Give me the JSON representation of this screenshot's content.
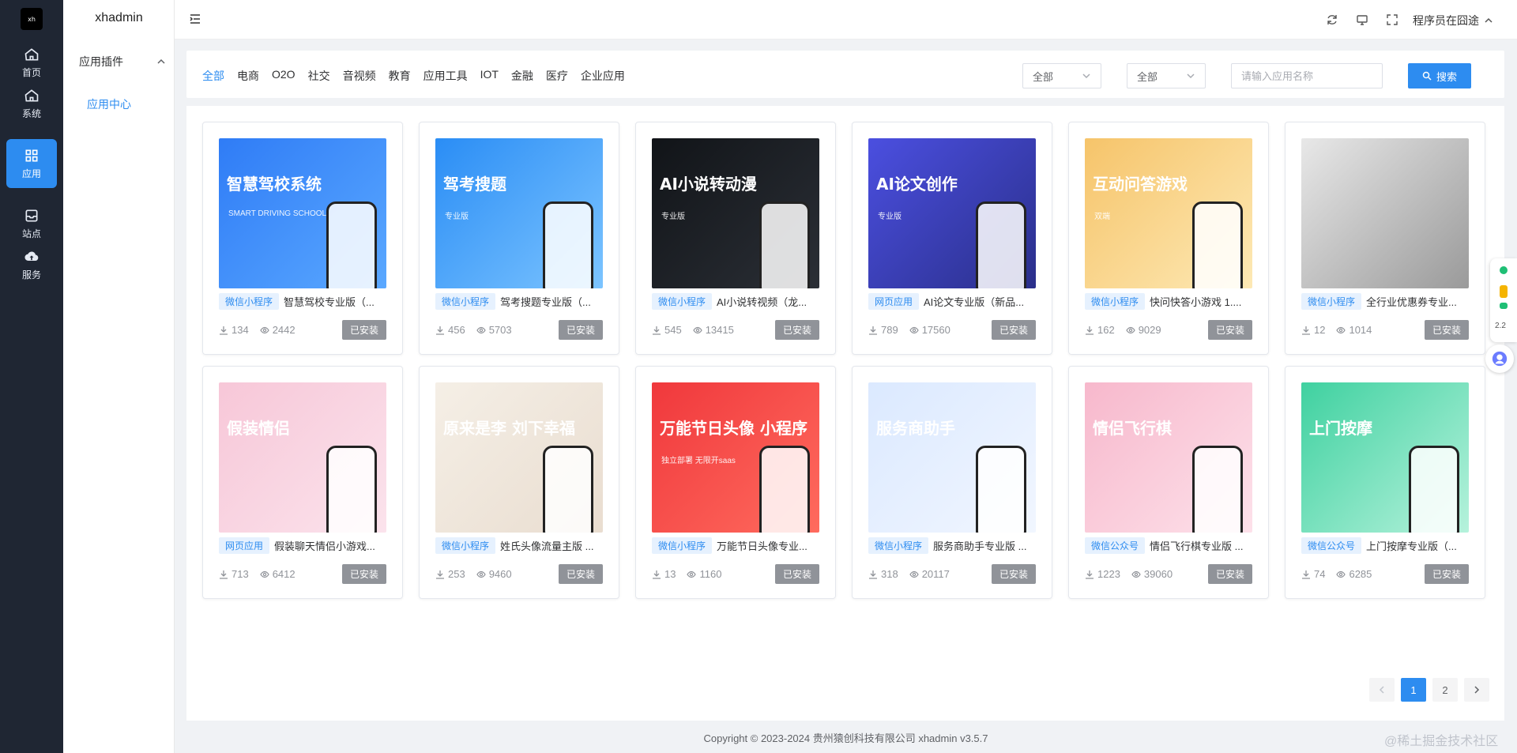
{
  "app": {
    "logo_text": "xh",
    "title": "xhadmin"
  },
  "rail": [
    {
      "label": "首页",
      "icon": "home-icon"
    },
    {
      "label": "系统",
      "icon": "home-icon"
    },
    {
      "label": "应用",
      "icon": "grid-icon"
    },
    {
      "label": "站点",
      "icon": "inbox-icon"
    },
    {
      "label": "服务",
      "icon": "cloud-upload-icon"
    }
  ],
  "panel": {
    "group": "应用插件",
    "link": "应用中心"
  },
  "header": {
    "user": "程序员在囧途"
  },
  "filters": {
    "categories": [
      "全部",
      "电商",
      "O2O",
      "社交",
      "音视频",
      "教育",
      "应用工具",
      "IOT",
      "金融",
      "医疗",
      "企业应用"
    ],
    "select1": "全部",
    "select2": "全部",
    "search_placeholder": "请输入应用名称",
    "search_button": "搜索"
  },
  "apps": [
    {
      "thumb_title": "智慧驾校系统",
      "thumb_sub": "SMART DRIVING SCHOOL",
      "tag": "微信小程序",
      "name": "智慧驾校专业版（...",
      "downloads": "134",
      "views": "2442",
      "status": "已安装",
      "bg": "#2f7cf6",
      "bg2": "#5aa8ff"
    },
    {
      "thumb_title": "驾考搜题",
      "thumb_sub": "专业版",
      "tag": "微信小程序",
      "name": "驾考搜题专业版（...",
      "downloads": "456",
      "views": "5703",
      "status": "已安装",
      "bg": "#2a8df5",
      "bg2": "#7cc4ff"
    },
    {
      "thumb_title": "AI小说转动漫",
      "thumb_sub": "专业版",
      "tag": "微信小程序",
      "name": "AI小说转视频（龙...",
      "downloads": "545",
      "views": "13415",
      "status": "已安装",
      "bg": "#111418",
      "bg2": "#2b2f36"
    },
    {
      "thumb_title": "AI论文创作",
      "thumb_sub": "专业版",
      "tag": "网页应用",
      "name": "AI论文专业版（新品...",
      "downloads": "789",
      "views": "17560",
      "status": "已安装",
      "bg": "#4b4fe0",
      "bg2": "#2a2f8a"
    },
    {
      "thumb_title": "互动问答游戏",
      "thumb_sub": "双端",
      "tag": "微信小程序",
      "name": "快问快答小游戏 1....",
      "downloads": "162",
      "views": "9029",
      "status": "已安装",
      "bg": "#f6c46a",
      "bg2": "#fde9b5"
    },
    {
      "thumb_title": "",
      "thumb_sub": "",
      "tag": "微信小程序",
      "name": "全行业优惠券专业...",
      "downloads": "12",
      "views": "1014",
      "status": "已安装",
      "bg": "#e8e8e8",
      "bg2": "#9a9a9a"
    },
    {
      "thumb_title": "假装情侣",
      "thumb_sub": "",
      "tag": "网页应用",
      "name": "假装聊天情侣小游戏...",
      "downloads": "713",
      "views": "6412",
      "status": "已安装",
      "bg": "#f7c7d8",
      "bg2": "#fbe3ec"
    },
    {
      "thumb_title": "原来是李 刘下幸福",
      "thumb_sub": "",
      "tag": "微信小程序",
      "name": "姓氏头像流量主版 ...",
      "downloads": "253",
      "views": "9460",
      "status": "已安装",
      "bg": "#f5efe6",
      "bg2": "#e9ddd0"
    },
    {
      "thumb_title": "万能节日头像 小程序",
      "thumb_sub": "独立部署 无限开saas",
      "tag": "微信小程序",
      "name": "万能节日头像专业...",
      "downloads": "13",
      "views": "1160",
      "status": "已安装",
      "bg": "#f0383c",
      "bg2": "#ff6b5e"
    },
    {
      "thumb_title": "服务商助手",
      "thumb_sub": "",
      "tag": "微信小程序",
      "name": "服务商助手专业版 ...",
      "downloads": "318",
      "views": "20117",
      "status": "已安装",
      "bg": "#dbe9ff",
      "bg2": "#f1f6ff"
    },
    {
      "thumb_title": "情侣飞行棋",
      "thumb_sub": "",
      "tag": "微信公众号",
      "name": "情侣飞行棋专业版 ...",
      "downloads": "1223",
      "views": "39060",
      "status": "已安装",
      "bg": "#f7b8cc",
      "bg2": "#fde1ea"
    },
    {
      "thumb_title": "上门按摩",
      "thumb_sub": "",
      "tag": "微信公众号",
      "name": "上门按摩专业版（...",
      "downloads": "74",
      "views": "6285",
      "status": "已安装",
      "bg": "#3fd1a0",
      "bg2": "#b6f2dc"
    }
  ],
  "pagination": {
    "pages": [
      "1",
      "2"
    ],
    "current": "1"
  },
  "footer": "Copyright © 2023-2024 贵州猿创科技有限公司  xhadmin v3.5.7",
  "float": {
    "number": "2.2"
  },
  "watermark": "@稀土掘金技术社区"
}
